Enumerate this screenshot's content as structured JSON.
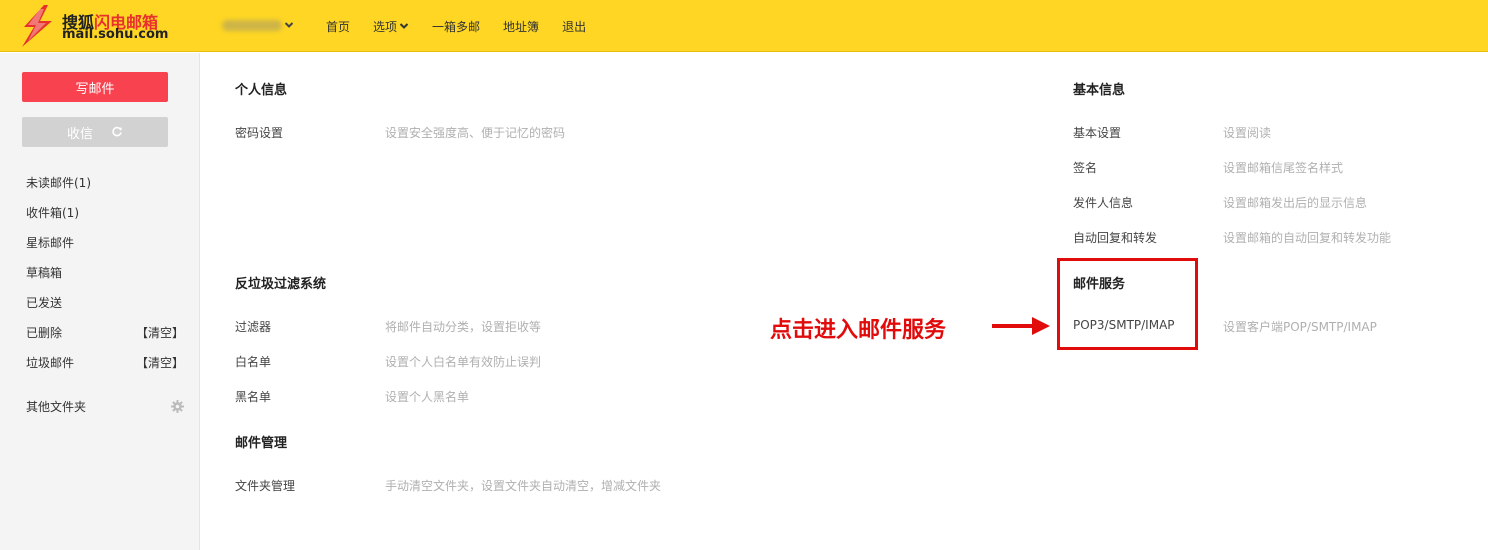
{
  "header": {
    "logo_title_main": "搜狐",
    "logo_title_accent": "闪电邮箱",
    "logo_domain": "mail.sohu.com",
    "account_name": "••••••••",
    "nav": [
      {
        "label": "首页"
      },
      {
        "label": "选项",
        "has_dropdown": true
      },
      {
        "label": "一箱多邮"
      },
      {
        "label": "地址簿"
      },
      {
        "label": "退出"
      }
    ],
    "colors": {
      "background": "#fed623",
      "accent": "#e8302c"
    }
  },
  "sidebar": {
    "compose_label": "写邮件",
    "receive_label": "收信",
    "folders": [
      {
        "label": "未读邮件(1)"
      },
      {
        "label": "收件箱(1)"
      },
      {
        "label": "星标邮件"
      },
      {
        "label": "草稿箱"
      },
      {
        "label": "已发送"
      },
      {
        "label": "已删除",
        "action": "【清空】"
      },
      {
        "label": "垃圾邮件",
        "action": "【清空】"
      }
    ],
    "other_folders_label": "其他文件夹",
    "colors": {
      "compose": "#f8424f",
      "receive": "#d2d2d2"
    }
  },
  "settings": {
    "personal": {
      "title": "个人信息",
      "rows": [
        {
          "label": "密码设置",
          "desc": "设置安全强度高、便于记忆的密码"
        }
      ]
    },
    "basic": {
      "title": "基本信息",
      "rows": [
        {
          "label": "基本设置",
          "desc": "设置阅读"
        },
        {
          "label": "签名",
          "desc": "设置邮箱信尾签名样式"
        },
        {
          "label": "发件人信息",
          "desc": "设置邮箱发出后的显示信息"
        },
        {
          "label": "自动回复和转发",
          "desc": "设置邮箱的自动回复和转发功能"
        }
      ]
    },
    "antispam": {
      "title": "反垃圾过滤系统",
      "rows": [
        {
          "label": "过滤器",
          "desc": "将邮件自动分类，设置拒收等"
        },
        {
          "label": "白名单",
          "desc": "设置个人白名单有效防止误判"
        },
        {
          "label": "黑名单",
          "desc": "设置个人黑名单"
        }
      ]
    },
    "mail_service": {
      "title": "邮件服务",
      "rows": [
        {
          "label": "POP3/SMTP/IMAP",
          "desc": "设置客户端POP/SMTP/IMAP"
        }
      ]
    },
    "mail_manage": {
      "title": "邮件管理",
      "rows": [
        {
          "label": "文件夹管理",
          "desc": "手动清空文件夹，设置文件夹自动清空，增减文件夹"
        }
      ]
    }
  },
  "annotation": {
    "text": "点击进入邮件服务",
    "color": "#e10b0b"
  }
}
